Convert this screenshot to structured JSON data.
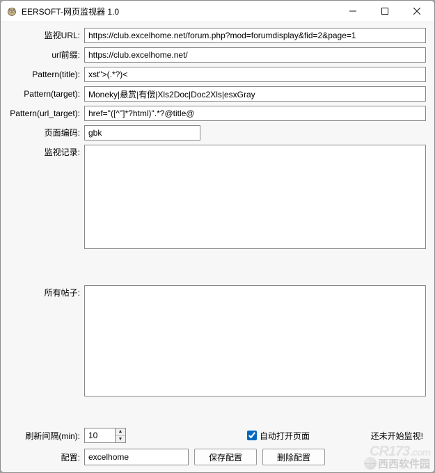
{
  "window": {
    "title": "EERSOFT-网页监视器 1.0"
  },
  "labels": {
    "url": "监视URL:",
    "prefix": "url前缀:",
    "pattern_title": "Pattern(title):",
    "pattern_target": "Pattern(target):",
    "pattern_url_target": "Pattern(url_target):",
    "encoding": "页面编码:",
    "records": "监视记录:",
    "posts": "所有帖子:",
    "interval": "刷新间隔(min):",
    "auto_open": "自动打开页面",
    "config": "配置:",
    "btn_save": "保存配置",
    "btn_delete": "删除配置",
    "status": "还未开始监视!"
  },
  "fields": {
    "url": "https://club.excelhome.net/forum.php?mod=forumdisplay&fid=2&page=1",
    "prefix": "https://club.excelhome.net/",
    "pattern_title": "xst\">(.*?)<",
    "pattern_target": "Moneky|悬赏|有偿|Xls2Doc|Doc2Xls|esxGray",
    "pattern_url_target": "href=\"([^\"]*?html)\".*?@title@",
    "encoding": "gbk",
    "records": "",
    "posts": "",
    "interval": "10",
    "auto_open_checked": true,
    "config_selected": "excelhome"
  },
  "watermark": {
    "line1_main": "CR173",
    "line1_suffix": ".com",
    "line2": "西西软件园"
  }
}
